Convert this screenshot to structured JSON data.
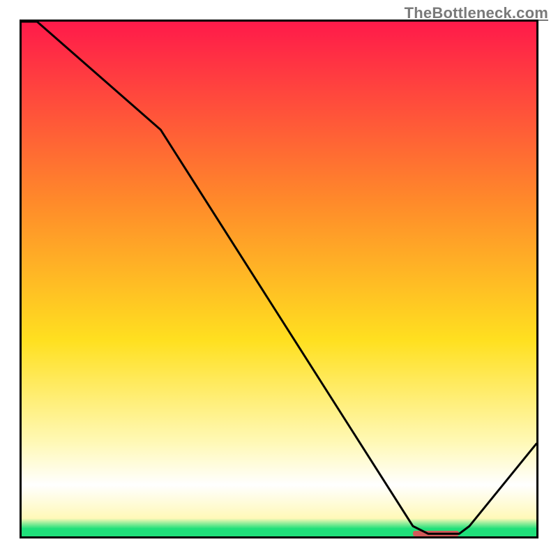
{
  "attribution": "TheBottleneck.com",
  "colors": {
    "top": "#ff1a4a",
    "mid_upper": "#ff8a2a",
    "mid": "#ffe020",
    "pale_yellow": "#fff9b8",
    "band_white": "#ffffff",
    "green": "#1fe07a",
    "curve": "#000000",
    "marker": "#d15a5a",
    "border": "#000000"
  },
  "chart_data": {
    "type": "line",
    "title": "",
    "xlabel": "",
    "ylabel": "",
    "xlim": [
      0,
      100
    ],
    "ylim": [
      0,
      100
    ],
    "x": [
      0,
      3,
      27,
      76,
      79,
      85,
      87,
      100
    ],
    "series": [
      {
        "name": "curve",
        "values": [
          100,
          100,
          79,
          2,
          0.5,
          0.5,
          2,
          18
        ]
      }
    ],
    "marker": {
      "x_start": 76,
      "x_end": 85,
      "y": 0.5
    },
    "gradient_stops": [
      {
        "offset": 0.0,
        "color_key": "top"
      },
      {
        "offset": 0.35,
        "color_key": "mid_upper"
      },
      {
        "offset": 0.62,
        "color_key": "mid"
      },
      {
        "offset": 0.82,
        "color_key": "pale_yellow"
      },
      {
        "offset": 0.9,
        "color_key": "band_white"
      },
      {
        "offset": 0.965,
        "color_key": "pale_yellow"
      },
      {
        "offset": 0.985,
        "color_key": "green"
      },
      {
        "offset": 1.0,
        "color_key": "green"
      }
    ]
  }
}
